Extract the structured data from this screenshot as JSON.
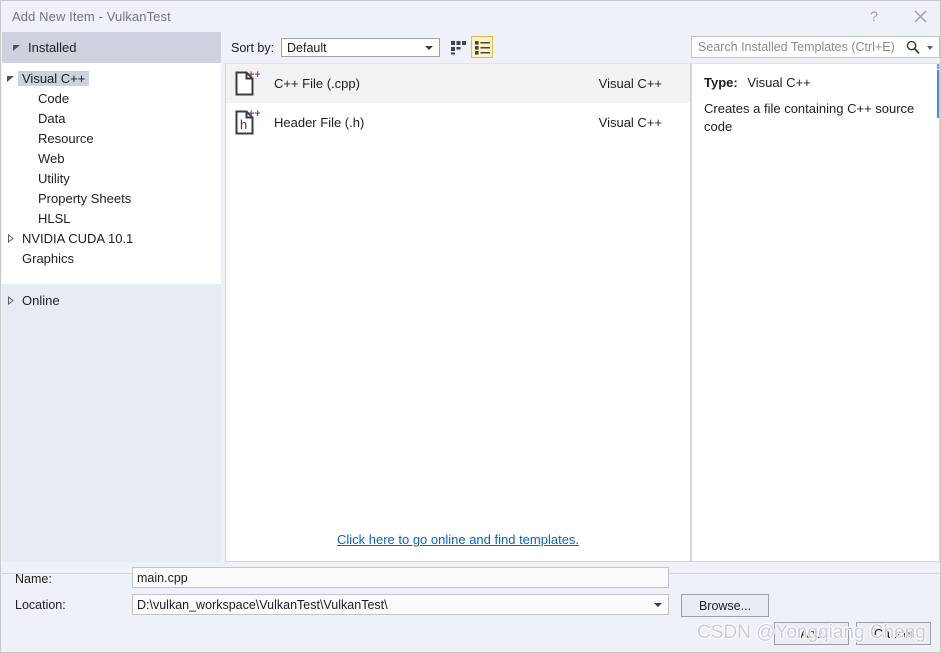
{
  "window": {
    "title": "Add New Item - VulkanTest",
    "help_icon": "question-mark-icon",
    "close_icon": "close-icon"
  },
  "sidebar": {
    "header": "Installed",
    "tree": [
      {
        "label": "Visual C++",
        "level": 0,
        "state": "expanded",
        "selected": true
      },
      {
        "label": "Code",
        "level": 1,
        "state": "leaf",
        "selected": false
      },
      {
        "label": "Data",
        "level": 1,
        "state": "leaf",
        "selected": false
      },
      {
        "label": "Resource",
        "level": 1,
        "state": "leaf",
        "selected": false
      },
      {
        "label": "Web",
        "level": 1,
        "state": "leaf",
        "selected": false
      },
      {
        "label": "Utility",
        "level": 1,
        "state": "leaf",
        "selected": false
      },
      {
        "label": "Property Sheets",
        "level": 1,
        "state": "leaf",
        "selected": false
      },
      {
        "label": "HLSL",
        "level": 1,
        "state": "leaf",
        "selected": false
      },
      {
        "label": "NVIDIA CUDA 10.1",
        "level": 0,
        "state": "collapsed",
        "selected": false
      },
      {
        "label": "Graphics",
        "level": 0,
        "state": "leaf",
        "selected": false
      }
    ],
    "online": {
      "label": "Online",
      "state": "collapsed"
    }
  },
  "toolbar": {
    "sort_by_label": "Sort by:",
    "sort_by_value": "Default",
    "tiles_view_icon": "grid-view-icon",
    "list_view_icon": "list-view-icon",
    "list_view_selected": true,
    "selected_border_color": "#e2b949",
    "selected_fill_color": "#fdf4bf"
  },
  "search": {
    "placeholder": "Search Installed Templates (Ctrl+E)",
    "value": "",
    "icon": "search-icon",
    "dropdown_icon": "chevron-down-icon"
  },
  "templates": {
    "items": [
      {
        "name": "C++ File (.cpp)",
        "category": "Visual C++",
        "icon": "cpp-file-icon",
        "selected": true
      },
      {
        "name": "Header File (.h)",
        "category": "Visual C++",
        "icon": "header-file-icon",
        "selected": false
      }
    ],
    "online_link": "Click here to go online and find templates."
  },
  "details": {
    "type_label": "Type:",
    "type_value": "Visual C++",
    "description": "Creates a file containing C++ source code"
  },
  "fields": {
    "name_label": "Name:",
    "name_value": "main.cpp",
    "location_label": "Location:",
    "location_value": "D:\\vulkan_workspace\\VulkanTest\\VulkanTest\\"
  },
  "buttons": {
    "browse": "Browse...",
    "add": "Add",
    "cancel": "Cancel"
  },
  "watermark": "CSDN @Yongqiang Cheng"
}
